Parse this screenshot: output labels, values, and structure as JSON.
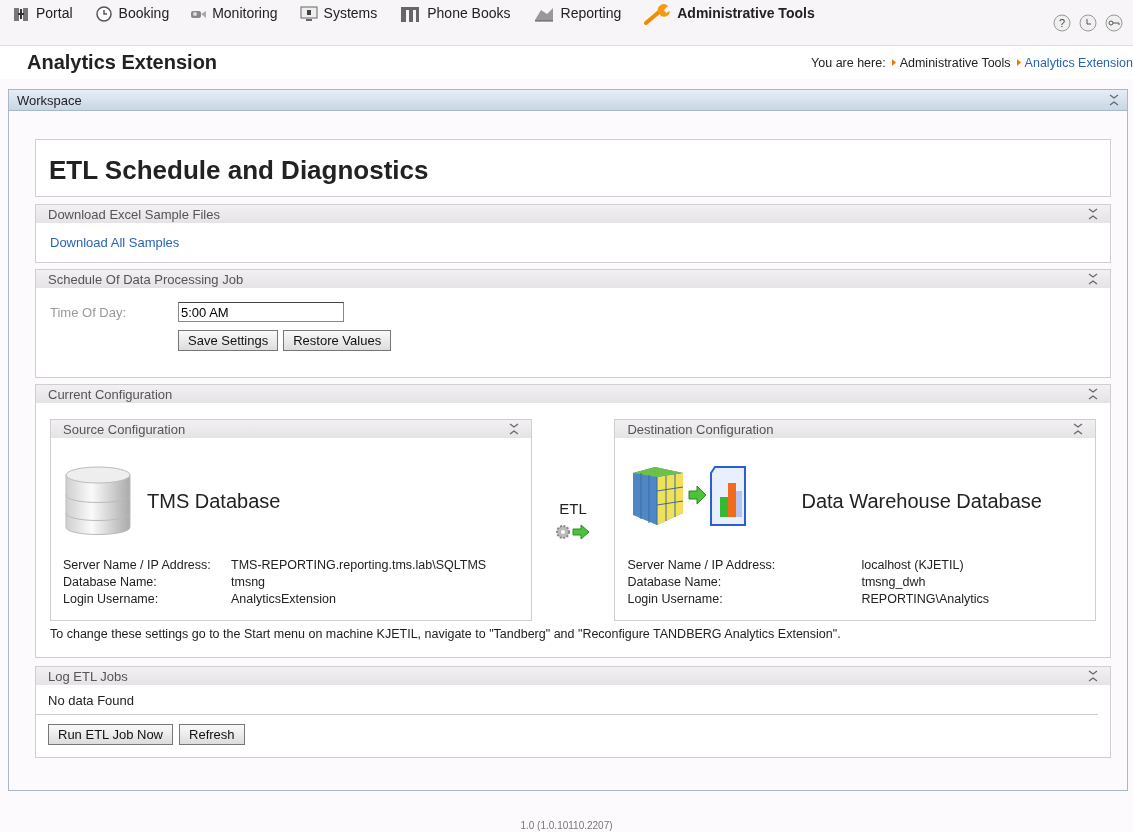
{
  "nav": [
    {
      "label": "Portal",
      "selected": false
    },
    {
      "label": "Booking",
      "selected": false
    },
    {
      "label": "Monitoring",
      "selected": false
    },
    {
      "label": "Systems",
      "selected": false
    },
    {
      "label": "Phone Books",
      "selected": false
    },
    {
      "label": "Reporting",
      "selected": false
    },
    {
      "label": "Administrative Tools",
      "selected": true
    }
  ],
  "help_glyph": "?",
  "page_title": "Analytics Extension",
  "breadcrumb": {
    "prefix": "You are here:",
    "items": [
      {
        "label": "Administrative Tools",
        "selected": false
      },
      {
        "label": "Analytics Extension",
        "selected": true
      }
    ]
  },
  "workspace": {
    "title": "Workspace"
  },
  "main_title": "ETL Schedule and Diagnostics",
  "download": {
    "title": "Download Excel Sample Files",
    "link": "Download All Samples"
  },
  "schedule": {
    "title": "Schedule Of Data Processing Job",
    "field_label": "Time Of Day:",
    "value": "5:00 AM",
    "buttons": [
      "Save Settings",
      "Restore Values"
    ]
  },
  "configuration": {
    "title": "Current Configuration",
    "etl_label": "ETL",
    "source": {
      "title": "Source Configuration",
      "name": "TMS Database",
      "rows": [
        {
          "label": "Server Name / IP Address:",
          "value": "TMS-REPORTING.reporting.tms.lab\\SQLTMS"
        },
        {
          "label": "Database Name:",
          "value": "tmsng"
        },
        {
          "label": "Login Username:",
          "value": "AnalyticsExtension"
        }
      ]
    },
    "destination": {
      "title": "Destination Configuration",
      "name": "Data Warehouse Database",
      "rows": [
        {
          "label": "Server Name / IP Address:",
          "value": "localhost (KJETIL)"
        },
        {
          "label": "Database Name:",
          "value": "tmsng_dwh"
        },
        {
          "label": "Login Username:",
          "value": "REPORTING\\Analytics"
        }
      ]
    },
    "note": "To change these settings go to the Start menu on machine KJETIL, navigate to \"Tandberg\" and \"Reconfigure TANDBERG Analytics Extension\"."
  },
  "log": {
    "title": "Log ETL Jobs",
    "message": "No data Found",
    "buttons": [
      "Run ETL Job Now",
      "Refresh"
    ]
  },
  "version": "1.0 (1.0.10110.2207)"
}
